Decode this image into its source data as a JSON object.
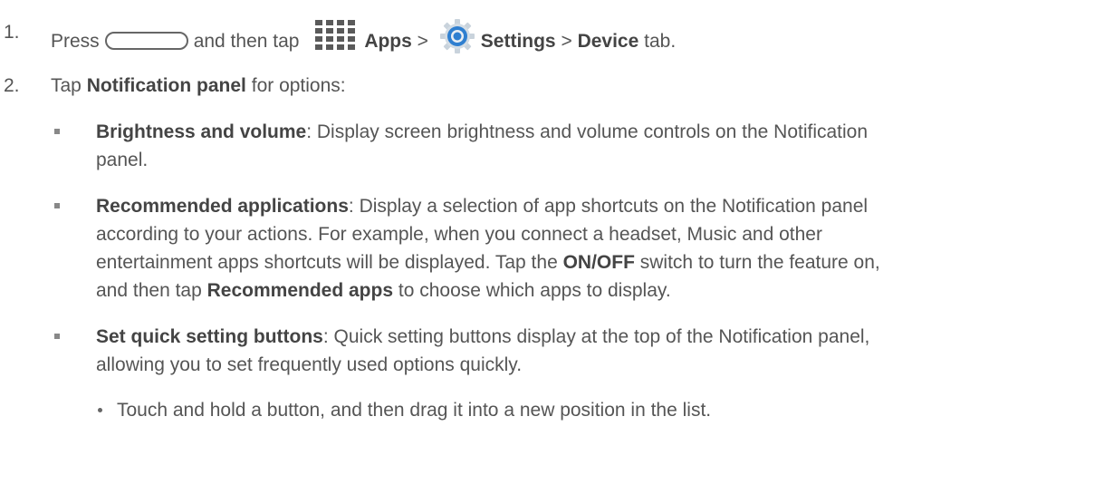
{
  "step1": {
    "number": "1.",
    "press": "Press",
    "and_then_tap": "and then tap",
    "apps": "Apps",
    "sep1": ">",
    "settings": "Settings",
    "sep2": ">",
    "device": "Device",
    "tab": "tab."
  },
  "step2": {
    "number": "2.",
    "tap": "Tap",
    "notification_panel": "Notification panel",
    "for_options": "for options:"
  },
  "bullets": [
    {
      "title": "Brightness and volume",
      "line1": ": Display screen brightness and volume controls on the Notification",
      "line2": "panel."
    },
    {
      "title": "Recommended applications",
      "line1": ": Display a selection of app shortcuts on the Notification panel",
      "line2": "according to your actions. For example, when you connect a headset, Music and other",
      "line3": "entertainment apps shortcuts will be displayed. Tap the",
      "on_off": "ON/OFF",
      "line3b": "switch to turn the feature on,",
      "line4a": "and then tap",
      "recommended_apps": "Recommended apps",
      "line4b": "to choose which apps to display."
    },
    {
      "title": "Set quick setting buttons",
      "line1": ": Quick setting buttons display at the top of the Notification panel,",
      "line2": "allowing you to set frequently used options quickly."
    }
  ],
  "sub_bullet": {
    "text": "Touch and hold a button, and then drag it into a new position in the list."
  },
  "icons": {
    "home": "home-button-icon",
    "apps": "apps-grid-icon",
    "settings": "settings-gear-icon"
  }
}
